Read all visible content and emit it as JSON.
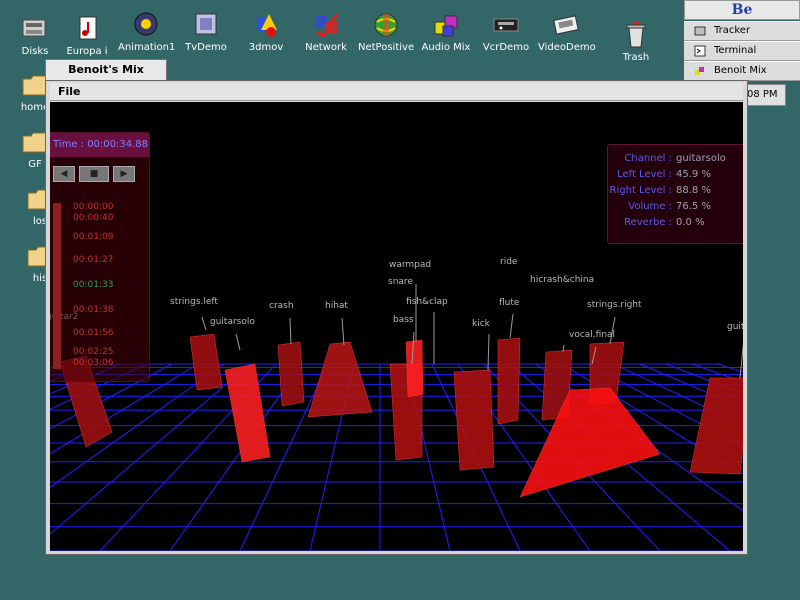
{
  "desktop": {
    "icons": [
      {
        "label": "Disks",
        "icon": "disk-icon"
      },
      {
        "label": "Europa i",
        "icon": "music-doc-icon"
      },
      {
        "label": "Animation1",
        "icon": "animation-icon"
      },
      {
        "label": "TvDemo",
        "icon": "tv-icon"
      },
      {
        "label": "3dmov",
        "icon": "3d-shapes-icon"
      },
      {
        "label": "Network",
        "icon": "network-icon"
      },
      {
        "label": "NetPositive",
        "icon": "globe-icon"
      },
      {
        "label": "Audio Mix",
        "icon": "cubes-icon"
      },
      {
        "label": "VcrDemo",
        "icon": "vcr-icon"
      },
      {
        "label": "VideoDemo",
        "icon": "video-icon"
      },
      {
        "label": "Trash",
        "icon": "trash-icon"
      }
    ],
    "side_icons": [
      {
        "label": "home",
        "icon": "folder-icon"
      },
      {
        "label": "GF",
        "icon": "folder-icon"
      },
      {
        "label": "los",
        "icon": "folder-icon"
      },
      {
        "label": "his",
        "icon": "folder-icon"
      }
    ]
  },
  "deskbar": {
    "be_label": "Be",
    "items": [
      {
        "label": "Tracker"
      },
      {
        "label": "Terminal"
      },
      {
        "label": "Benoit Mix"
      }
    ],
    "clock": "08 PM"
  },
  "window": {
    "title": "Benoit's Mix",
    "menu": [
      "File"
    ]
  },
  "transport": {
    "time": "Time : 00:00:34.88",
    "buttons": [
      "◀",
      "■",
      "▶"
    ],
    "marks": [
      "00:00:00",
      "00:00:40",
      "00:01:09",
      "00:01:27",
      "00:01:33",
      "00:01:38",
      "00:01:56",
      "00:02:25",
      "00:03:06"
    ]
  },
  "channel": {
    "rows": [
      {
        "key": "Channel :",
        "value": "guitarsolo"
      },
      {
        "key": "Left Level :",
        "value": "45.9 %"
      },
      {
        "key": "Right Level :",
        "value": "88.8 %"
      },
      {
        "key": "Volume :",
        "value": "76.5 %"
      },
      {
        "key": "Reverbe :",
        "value": "0.0 %"
      }
    ]
  },
  "instruments": [
    "warmpad",
    "ride",
    "snare",
    "hicrash&china",
    "fish&clap",
    "strings.left",
    "crash",
    "hihat",
    "flute",
    "strings.right",
    "guitarsolo",
    "bass",
    "kick",
    "vocal.final",
    "guitar2",
    "guit"
  ],
  "colors": {
    "desktop": "#336666",
    "grid": "#2020ff",
    "block": "#ff1010",
    "panel_text": "#5a5ae8"
  }
}
